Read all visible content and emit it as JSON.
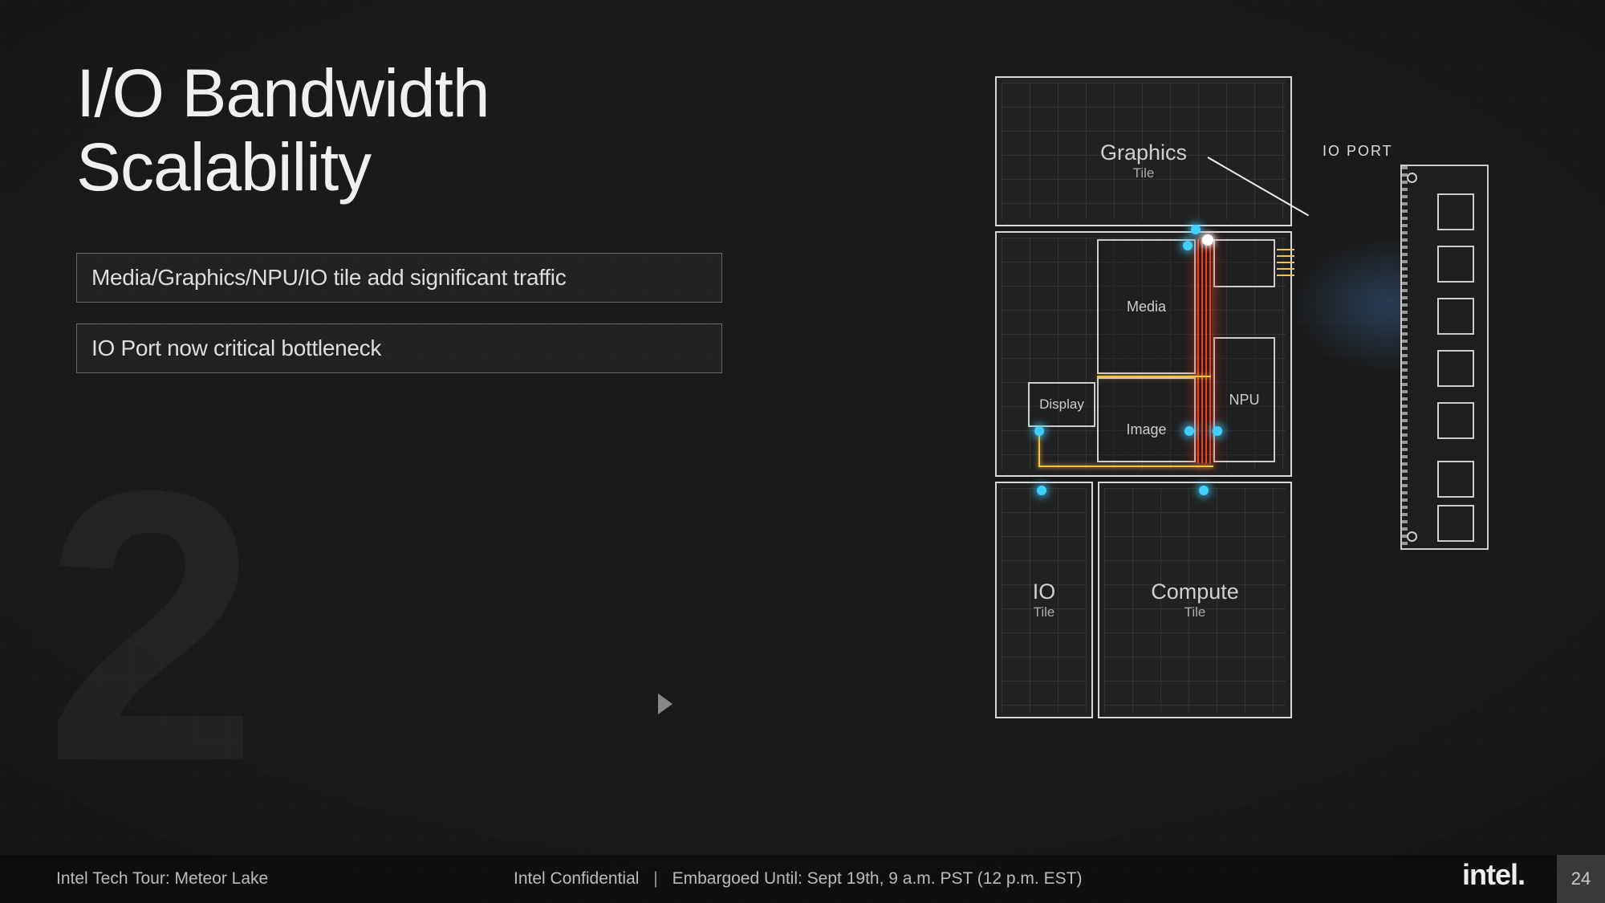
{
  "title_line1": "I/O Bandwidth",
  "title_line2": "Scalability",
  "bullets": [
    "Media/Graphics/NPU/IO tile add significant traffic",
    "IO Port now critical bottleneck"
  ],
  "big_number": "2",
  "io_port_label": "IO PORT",
  "tiles": {
    "graphics": {
      "name": "Graphics",
      "sub": "Tile"
    },
    "soc": {
      "media": "Media",
      "display": "Display",
      "image": "Image",
      "npu": "NPU"
    },
    "io": {
      "name": "IO",
      "sub": "Tile"
    },
    "compute": {
      "name": "Compute",
      "sub": "Tile"
    }
  },
  "footer": {
    "left": "Intel Tech Tour: Meteor Lake",
    "mid_a": "Intel Confidential",
    "mid_b": "Embargoed Until: Sept 19th, 9 a.m. PST (12 p.m. EST)",
    "logo": "intel",
    "page": "24"
  }
}
